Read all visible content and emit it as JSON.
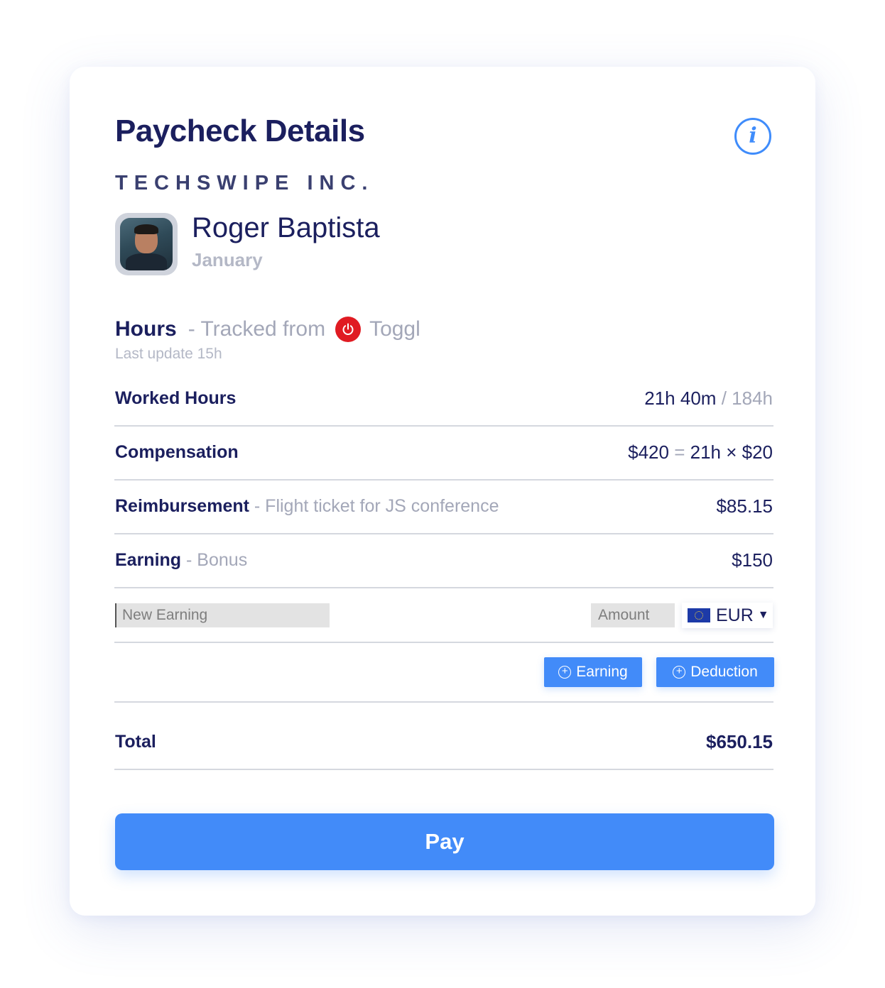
{
  "header": {
    "title": "Paycheck Details",
    "company": "TECHSWIPE INC.",
    "info_icon": "info-icon"
  },
  "employee": {
    "name": "Roger Baptista",
    "period": "January"
  },
  "hours": {
    "heading": "Hours",
    "source_prefix": "- Tracked from",
    "source_name": "Toggl",
    "source_icon": "toggl-power-icon",
    "last_update": "Last update 15h"
  },
  "rows": {
    "worked_hours": {
      "label": "Worked Hours",
      "value": "21h 40m",
      "sep": "/",
      "total": "184h"
    },
    "compensation": {
      "label": "Compensation",
      "amount": "$420",
      "eq": "=",
      "formula": "21h × $20"
    },
    "reimbursement": {
      "label": "Reimbursement",
      "desc": "- Flight ticket for JS conference",
      "value": "$85.15"
    },
    "earning": {
      "label": "Earning",
      "desc": "- Bonus",
      "value": "$150"
    }
  },
  "new_entry": {
    "name_placeholder": "New Earning",
    "amount_placeholder": "Amount",
    "currency": "EUR",
    "currency_icon": "eu-flag-icon"
  },
  "actions": {
    "add_earning": "Earning",
    "add_deduction": "Deduction"
  },
  "total": {
    "label": "Total",
    "value": "$650.15"
  },
  "pay_button": "Pay",
  "colors": {
    "accent": "#428bf9",
    "text_dark": "#1b1f5e",
    "text_muted": "#a3a7b8",
    "toggl_red": "#e01b22"
  }
}
